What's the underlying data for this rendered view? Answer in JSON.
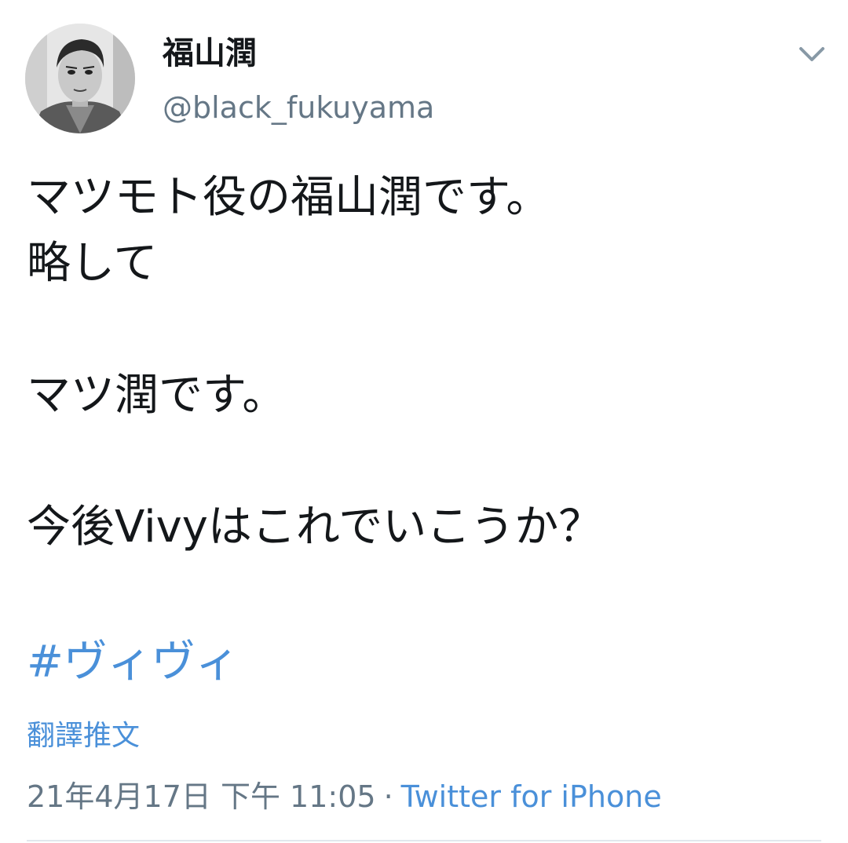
{
  "tweet": {
    "author": {
      "display_name": "福山潤",
      "handle": "@black_fukuyama"
    },
    "menu_icon": "chevron-down-icon",
    "body_lines": [
      "マツモト役の福山潤です。",
      "略して",
      "",
      "マツ潤です。",
      "",
      "今後Vivyはこれでいこうか？"
    ],
    "hashtag": "#ヴィヴィ",
    "translate_label": "翻譯推文",
    "timestamp": "21年4月17日 下午 11:05",
    "separator": "·",
    "source": "Twitter for iPhone"
  },
  "colors": {
    "text": "#14171a",
    "secondary": "#657786",
    "link": "#4a90d9",
    "divider": "#e1e8ed"
  }
}
